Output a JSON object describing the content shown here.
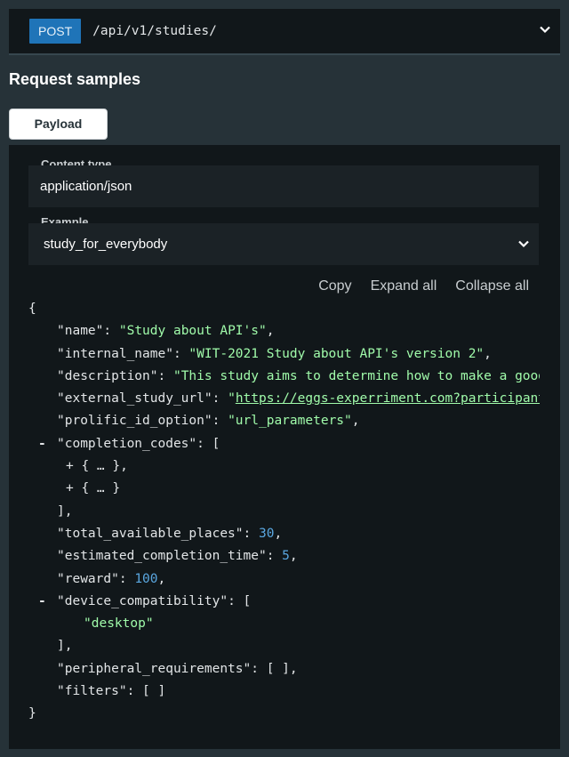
{
  "endpoint": {
    "method": "POST",
    "path": "/api/v1/studies/"
  },
  "section_title": "Request samples",
  "tab": "Payload",
  "content_type": {
    "label": "Content type",
    "value": "application/json"
  },
  "example": {
    "label": "Example",
    "value": "study_for_everybody"
  },
  "actions": {
    "copy": "Copy",
    "expand_all": "Expand all",
    "collapse_all": "Collapse all"
  },
  "json": {
    "open_brace": "{",
    "close_brace": "}",
    "name_key": "\"name\"",
    "name_val": "\"Study about API's\"",
    "internal_name_key": "\"internal_name\"",
    "internal_name_val": "\"WIT-2021 Study about API's version 2\"",
    "description_key": "\"description\"",
    "description_val": "\"This study aims to determine how to make a good public API\"",
    "external_url_key": "\"external_study_url\"",
    "external_url_quote": "\"",
    "external_url_val": "https://eggs-experriment.com?participant={{%PROLIFIC_PID%}}",
    "prolific_key": "\"prolific_id_option\"",
    "prolific_val": "\"url_parameters\"",
    "completion_codes_key": "\"completion_codes\"",
    "collapsed_item_1": "{ … },",
    "collapsed_item_2": "{ … }",
    "total_places_key": "\"total_available_places\"",
    "total_places_val": "30",
    "est_time_key": "\"estimated_completion_time\"",
    "est_time_val": "5",
    "reward_key": "\"reward\"",
    "reward_val": "100",
    "device_key": "\"device_compatibility\"",
    "device_val": "\"desktop\"",
    "peripheral_key": "\"peripheral_requirements\"",
    "filters_key": "\"filters\"",
    "empty_array": "[ ]",
    "open_bracket": "[",
    "close_bracket_comma": "],",
    "colon": ": ",
    "comma": ",",
    "minus": "-",
    "plus": "+"
  },
  "colors": {
    "background": "#263238",
    "panel": "#11171a",
    "method_badge": "#1f74b8",
    "string": "#a0fbaa",
    "number": "#5aa7e0"
  },
  "icons": {
    "endpoint_toggle": "chevron-down-icon",
    "example_select": "chevron-down-icon"
  }
}
